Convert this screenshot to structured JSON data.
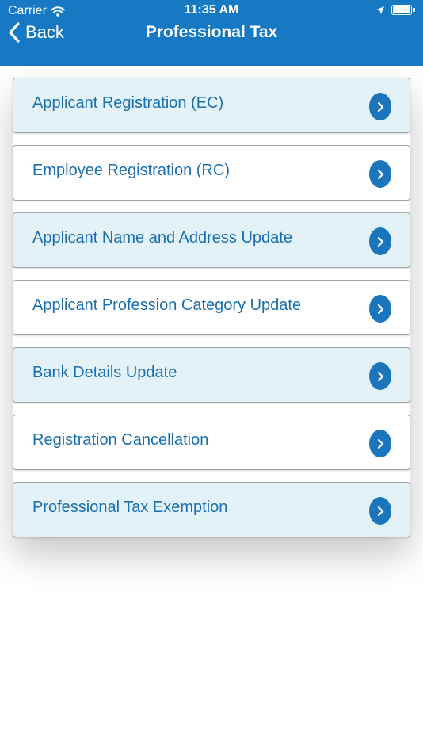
{
  "status_bar": {
    "carrier": "Carrier",
    "time": "11:35 AM"
  },
  "nav": {
    "back_label": "Back",
    "title": "Professional Tax"
  },
  "menu": {
    "items": [
      {
        "label": "Applicant Registration (EC)"
      },
      {
        "label": "Employee Registration (RC)"
      },
      {
        "label": "Applicant Name and Address Update"
      },
      {
        "label": "Applicant Profession Category Update"
      },
      {
        "label": "Bank Details Update"
      },
      {
        "label": "Registration Cancellation"
      },
      {
        "label": "Professional Tax Exemption"
      }
    ]
  },
  "colors": {
    "header": "#1779c4",
    "shaded_row": "#e3f2f6",
    "label_text": "#1a6fb1",
    "chevron_circle": "#1b75bd"
  },
  "icons": [
    "wifi-icon",
    "location-arrow-icon",
    "battery-icon",
    "back-chevron-icon",
    "chevron-right-icon"
  ]
}
